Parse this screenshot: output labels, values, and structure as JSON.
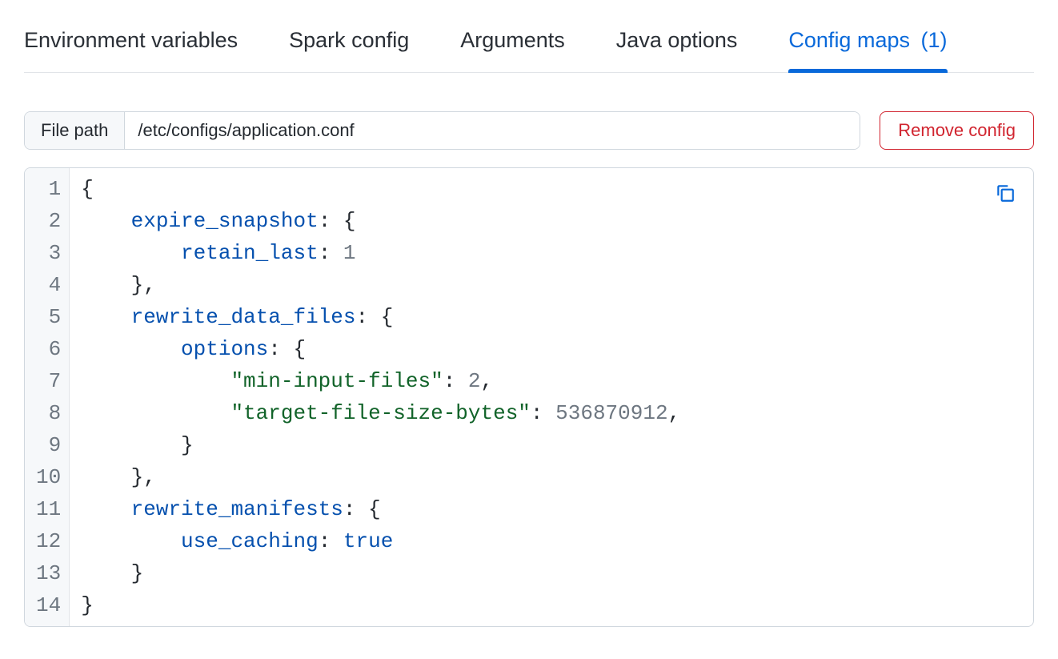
{
  "tabs": [
    {
      "label": "Environment variables",
      "count": null,
      "active": false
    },
    {
      "label": "Spark config",
      "count": null,
      "active": false
    },
    {
      "label": "Arguments",
      "count": null,
      "active": false
    },
    {
      "label": "Java options",
      "count": null,
      "active": false
    },
    {
      "label": "Config maps",
      "count": "(1)",
      "active": true
    }
  ],
  "file_path": {
    "label": "File path",
    "value": "/etc/configs/application.conf"
  },
  "actions": {
    "remove": "Remove config"
  },
  "editor": {
    "line_numbers": [
      "1",
      "2",
      "3",
      "4",
      "5",
      "6",
      "7",
      "8",
      "9",
      "10",
      "11",
      "12",
      "13",
      "14"
    ],
    "lines": [
      [
        {
          "t": "{",
          "c": "p"
        }
      ],
      [
        {
          "t": "    ",
          "c": "p"
        },
        {
          "t": "expire_snapshot",
          "c": "k"
        },
        {
          "t": ": {",
          "c": "p"
        }
      ],
      [
        {
          "t": "        ",
          "c": "p"
        },
        {
          "t": "retain_last",
          "c": "k"
        },
        {
          "t": ": ",
          "c": "p"
        },
        {
          "t": "1",
          "c": "n"
        }
      ],
      [
        {
          "t": "    },",
          "c": "p"
        }
      ],
      [
        {
          "t": "    ",
          "c": "p"
        },
        {
          "t": "rewrite_data_files",
          "c": "k"
        },
        {
          "t": ": {",
          "c": "p"
        }
      ],
      [
        {
          "t": "        ",
          "c": "p"
        },
        {
          "t": "options",
          "c": "k"
        },
        {
          "t": ": {",
          "c": "p"
        }
      ],
      [
        {
          "t": "            ",
          "c": "p"
        },
        {
          "t": "\"min-input-files\"",
          "c": "s"
        },
        {
          "t": ": ",
          "c": "p"
        },
        {
          "t": "2",
          "c": "n"
        },
        {
          "t": ",",
          "c": "p"
        }
      ],
      [
        {
          "t": "            ",
          "c": "p"
        },
        {
          "t": "\"target-file-size-bytes\"",
          "c": "s"
        },
        {
          "t": ": ",
          "c": "p"
        },
        {
          "t": "536870912",
          "c": "n"
        },
        {
          "t": ",",
          "c": "p"
        }
      ],
      [
        {
          "t": "        }",
          "c": "p"
        }
      ],
      [
        {
          "t": "    },",
          "c": "p"
        }
      ],
      [
        {
          "t": "    ",
          "c": "p"
        },
        {
          "t": "rewrite_manifests",
          "c": "k"
        },
        {
          "t": ": {",
          "c": "p"
        }
      ],
      [
        {
          "t": "        ",
          "c": "p"
        },
        {
          "t": "use_caching",
          "c": "k"
        },
        {
          "t": ": ",
          "c": "p"
        },
        {
          "t": "true",
          "c": "b"
        }
      ],
      [
        {
          "t": "    }",
          "c": "p"
        }
      ],
      [
        {
          "t": "}",
          "c": "p"
        }
      ]
    ]
  }
}
